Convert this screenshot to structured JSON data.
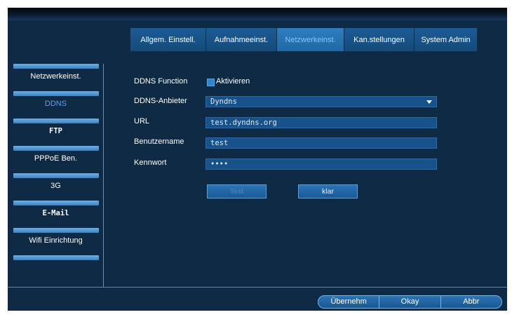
{
  "tabs": [
    "Allgem. Einstell.",
    "Aufnahmeeinst.",
    "Netzwerkeinst.",
    "Kan.stellungen",
    "System Admin"
  ],
  "sidebar": {
    "items": [
      {
        "label": "Netzwerkeinst."
      },
      {
        "label": "DDNS"
      },
      {
        "label": "FTP"
      },
      {
        "label": "PPPoE Ben."
      },
      {
        "label": "3G"
      },
      {
        "label": "E-Mail"
      },
      {
        "label": "Wifi Einrichtung"
      }
    ]
  },
  "form": {
    "ddns_function_label": "DDNS Function",
    "enable_label": "Aktivieren",
    "provider_label": "DDNS-Anbieter",
    "provider_value": "Dyndns",
    "url_label": "URL",
    "url_value": "test.dyndns.org",
    "username_label": "Benutzername",
    "username_value": "test",
    "password_label": "Kennwort",
    "password_value": "••••",
    "test_button": "Test",
    "clear_button": "klar"
  },
  "footer": {
    "apply": "Übernehm",
    "okay": "Okay",
    "cancel": "Abbr"
  },
  "colors": {
    "background": "#0f2a45",
    "tab": "#1c5c95",
    "tab_active": "#2d7fc1",
    "field": "#17528b",
    "active_text": "#83c6ff"
  }
}
